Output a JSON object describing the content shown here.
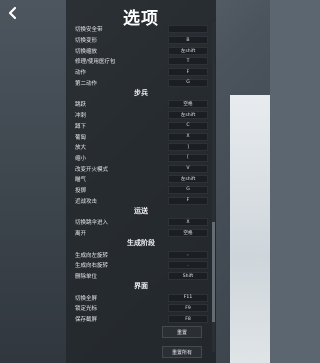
{
  "title": "选项",
  "rows": [
    {
      "type": "item",
      "label": "切换安全带",
      "key": ""
    },
    {
      "type": "item",
      "label": "切换变形",
      "key": "B"
    },
    {
      "type": "item",
      "label": "切换缩放",
      "key": "左shift"
    },
    {
      "type": "item",
      "label": "修理/使用医疗包",
      "key": "T"
    },
    {
      "type": "item",
      "label": "动作",
      "key": "F"
    },
    {
      "type": "item",
      "label": "第二动作",
      "key": "G"
    },
    {
      "type": "section",
      "label": "步兵"
    },
    {
      "type": "item",
      "label": "跳跃",
      "key": "空格"
    },
    {
      "type": "item",
      "label": "冲刺",
      "key": "左shift"
    },
    {
      "type": "item",
      "label": "蹲下",
      "key": "C"
    },
    {
      "type": "item",
      "label": "葡匐",
      "key": "X"
    },
    {
      "type": "item",
      "label": "放大",
      "key": "]"
    },
    {
      "type": "item",
      "label": "缩小",
      "key": "["
    },
    {
      "type": "item",
      "label": "改变开火模式",
      "key": "V"
    },
    {
      "type": "item",
      "label": "瞄气",
      "key": "左shift"
    },
    {
      "type": "item",
      "label": "投掷",
      "key": "G"
    },
    {
      "type": "item",
      "label": "近战攻击",
      "key": "F"
    },
    {
      "type": "section",
      "label": "运送"
    },
    {
      "type": "item",
      "label": "切换跳伞进入",
      "key": "X"
    },
    {
      "type": "item",
      "label": "离开",
      "key": "空格"
    },
    {
      "type": "section",
      "label": "生成阶段"
    },
    {
      "type": "item",
      "label": "生成向左旋转",
      "key": ","
    },
    {
      "type": "item",
      "label": "生成向右旋转",
      "key": "."
    },
    {
      "type": "item",
      "label": "删除单位",
      "key": "Shift"
    },
    {
      "type": "section",
      "label": "界面"
    },
    {
      "type": "item",
      "label": "切换全屏",
      "key": "F11"
    },
    {
      "type": "item",
      "label": "锁定光标",
      "key": "F9"
    },
    {
      "type": "item",
      "label": "保存截屏",
      "key": "F8"
    }
  ],
  "buttons": {
    "reset": "重置",
    "reset_all": "重置所有"
  }
}
